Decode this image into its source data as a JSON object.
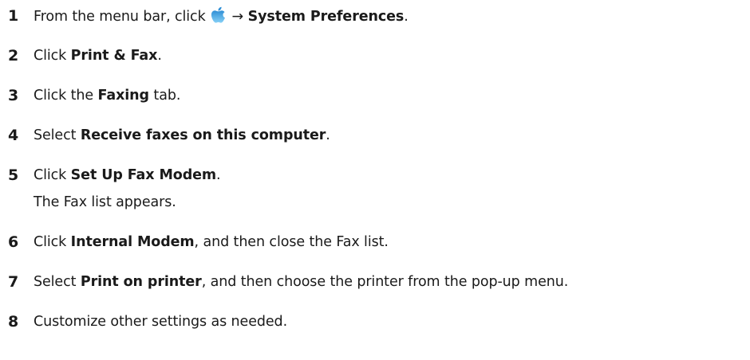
{
  "steps": [
    {
      "num": "1",
      "pre": "From the menu bar, click ",
      "arrow": "→",
      "bold": "System Preferences",
      "post": "."
    },
    {
      "num": "2",
      "pre": "Click ",
      "bold": "Print & Fax",
      "post": "."
    },
    {
      "num": "3",
      "pre": "Click the ",
      "bold": "Faxing",
      "post": " tab."
    },
    {
      "num": "4",
      "pre": "Select ",
      "bold": "Receive faxes on this computer",
      "post": "."
    },
    {
      "num": "5",
      "pre": "Click ",
      "bold": "Set Up Fax Modem",
      "post": ".",
      "note": "The Fax list appears."
    },
    {
      "num": "6",
      "pre": "Click ",
      "bold": "Internal Modem",
      "post": ", and then close the Fax list."
    },
    {
      "num": "7",
      "pre": "Select ",
      "bold": "Print on printer",
      "post": ", and then choose the printer from the pop-up menu."
    },
    {
      "num": "8",
      "text": "Customize other settings as needed."
    }
  ],
  "icons": {
    "apple_menu_icon": "apple-icon",
    "apple_color_top": "#3a9bdc",
    "apple_color_bottom": "#7ccbf5"
  }
}
